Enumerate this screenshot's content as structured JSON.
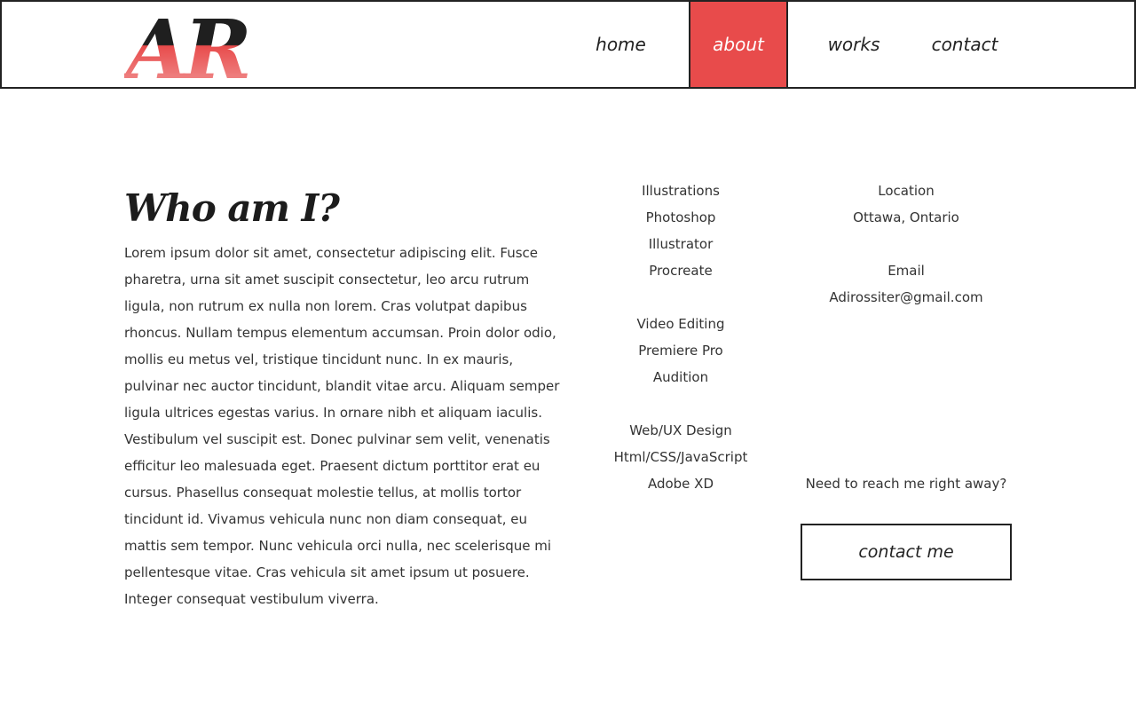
{
  "colors": {
    "accent": "#e84b4b",
    "text": "#222222",
    "border": "#222222"
  },
  "logo": {
    "letters": "AR"
  },
  "nav": {
    "home": "home",
    "about": "about",
    "works": "works",
    "contact": "contact"
  },
  "intro": {
    "title": "Who am I?",
    "body": "Lorem ipsum dolor sit amet, consectetur adipiscing elit. Fusce pharetra, urna sit amet suscipit consectetur, leo arcu rutrum ligula, non rutrum ex nulla non lorem. Cras volutpat dapibus rhoncus. Nullam tempus elementum accumsan. Proin dolor odio, mollis eu metus vel, tristique tincidunt nunc. In ex mauris, pulvinar nec auctor tincidunt, blandit vitae arcu. Aliquam semper ligula ultrices egestas varius. In ornare nibh et aliquam iaculis. Vestibulum vel suscipit est. Donec pulvinar sem velit, venenatis efficitur leo malesuada eget. Praesent dictum porttitor erat eu cursus. Phasellus consequat molestie tellus, at mollis tortor tincidunt id. Vivamus vehicula nunc non diam consequat, eu mattis sem tempor. Nunc vehicula orci nulla, nec scelerisque mi pellentesque vitae. Cras vehicula sit amet ipsum ut posuere. Integer consequat vestibulum viverra."
  },
  "skills": {
    "groups": [
      {
        "items": [
          "Illustrations",
          "Photoshop",
          "Illustrator",
          "Procreate"
        ]
      },
      {
        "items": [
          "Video Editing",
          "Premiere Pro",
          "Audition"
        ]
      },
      {
        "items": [
          "Web/UX Design",
          "Html/CSS/JavaScript",
          "Adobe XD"
        ]
      }
    ]
  },
  "info": {
    "location_label": "Location",
    "location_value": "Ottawa, Ontario",
    "email_label": "Email",
    "email_value": "Adirossiter@gmail.com"
  },
  "reach": {
    "prompt": "Need to reach me right away?",
    "button_label": "contact me"
  }
}
